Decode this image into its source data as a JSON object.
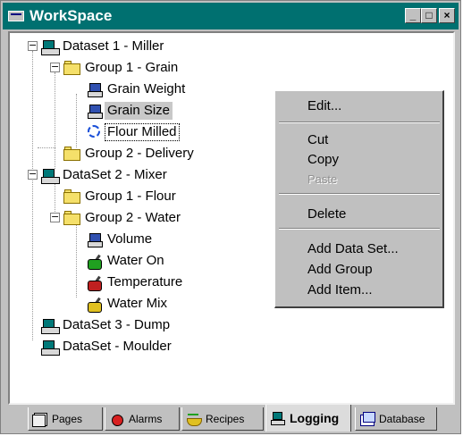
{
  "window": {
    "title": "WorkSpace",
    "minimize": "_",
    "maximize": "□",
    "close": "×"
  },
  "tree": [
    {
      "label": "Dataset 1 - Miller",
      "type": "dataset",
      "expander": "−"
    },
    {
      "label": "Group 1 - Grain",
      "type": "group",
      "expander": "−"
    },
    {
      "label": "Grain Weight",
      "type": "tag"
    },
    {
      "label": "Grain Size",
      "type": "tag",
      "selected": true
    },
    {
      "label": "Flour Milled",
      "type": "tag-dashed"
    },
    {
      "label": "Group 2 - Delivery",
      "type": "group"
    },
    {
      "label": "DataSet 2 - Mixer",
      "type": "dataset",
      "expander": "−"
    },
    {
      "label": "Group 1 - Flour",
      "type": "group"
    },
    {
      "label": "Group 2 - Water",
      "type": "group",
      "expander": "−"
    },
    {
      "label": "Volume",
      "type": "tag"
    },
    {
      "label": "Water On",
      "type": "valve",
      "color": "#20a020"
    },
    {
      "label": "Temperature",
      "type": "valve",
      "color": "#c02020"
    },
    {
      "label": "Water Mix",
      "type": "valve",
      "color": "#e0c020"
    },
    {
      "label": "DataSet 3 - Dump",
      "type": "dataset"
    },
    {
      "label": "DataSet - Moulder",
      "type": "dataset"
    }
  ],
  "context_menu": {
    "edit": "Edit...",
    "cut": "Cut",
    "copy": "Copy",
    "paste": "Paste",
    "delete": "Delete",
    "add_data_set": "Add Data Set...",
    "add_group": "Add Group",
    "add_item": "Add Item..."
  },
  "tabs": [
    {
      "label": "Pages",
      "icon": "pages-icon"
    },
    {
      "label": "Alarms",
      "icon": "alarm-icon"
    },
    {
      "label": "Recipes",
      "icon": "recipes-icon"
    },
    {
      "label": "Logging",
      "icon": "logging-icon",
      "active": true
    },
    {
      "label": "Database",
      "icon": "database-icon"
    }
  ],
  "colors": {
    "titlebar": "#007070",
    "selection": "#c8c8c8",
    "panel": "#c0c0c0"
  }
}
